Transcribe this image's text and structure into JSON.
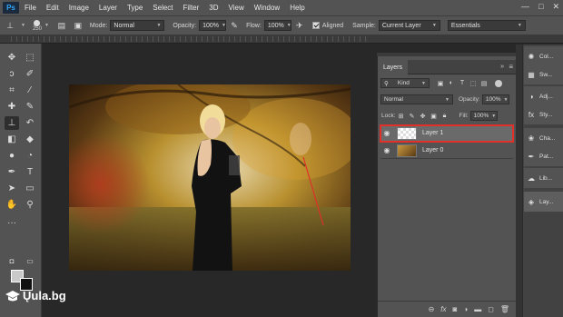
{
  "app": {
    "logo": "Ps"
  },
  "menu": [
    "File",
    "Edit",
    "Image",
    "Layer",
    "Type",
    "Select",
    "Filter",
    "3D",
    "View",
    "Window",
    "Help"
  ],
  "window_controls": {
    "minimize": "—",
    "maximize": "□",
    "close": "✕"
  },
  "options_bar": {
    "brush_size": "250",
    "mode_label": "Mode:",
    "mode_value": "Normal",
    "opacity_label": "Opacity:",
    "opacity_value": "100%",
    "flow_label": "Flow:",
    "flow_value": "100%",
    "aligned_label": "Aligned",
    "sample_label": "Sample:",
    "sample_value": "Current Layer",
    "workspace": "Essentials"
  },
  "layers_panel": {
    "tab": "Layers",
    "kind_label": "Kind",
    "blend_mode": "Normal",
    "opacity_label": "Opacity:",
    "opacity_value": "100%",
    "lock_label": "Lock:",
    "fill_label": "Fill:",
    "fill_value": "100%",
    "layers": [
      {
        "name": "Layer 1",
        "selected": true,
        "highlight_color": "#e0302a"
      },
      {
        "name": "Layer 0",
        "selected": false
      }
    ],
    "footer_icons": [
      "link-icon",
      "fx-icon",
      "mask-icon",
      "adjustment-icon",
      "folder-icon",
      "new-layer-icon",
      "trash-icon"
    ]
  },
  "dock": [
    {
      "label": "Col...",
      "icon": "color-icon"
    },
    {
      "label": "Sw...",
      "icon": "swatches-icon"
    },
    {
      "label": "Adj...",
      "icon": "adjustments-icon"
    },
    {
      "label": "Sty...",
      "icon": "styles-icon"
    },
    {
      "label": "Cha...",
      "icon": "channels-icon"
    },
    {
      "label": "Pat...",
      "icon": "paths-icon"
    },
    {
      "label": "Lib...",
      "icon": "libraries-icon"
    },
    {
      "label": "Lay...",
      "icon": "layers-icon"
    }
  ],
  "watermark": {
    "text": "Ųula.bg"
  },
  "colors": {
    "accent": "#31a8ff",
    "annotation": "#e0302a"
  }
}
